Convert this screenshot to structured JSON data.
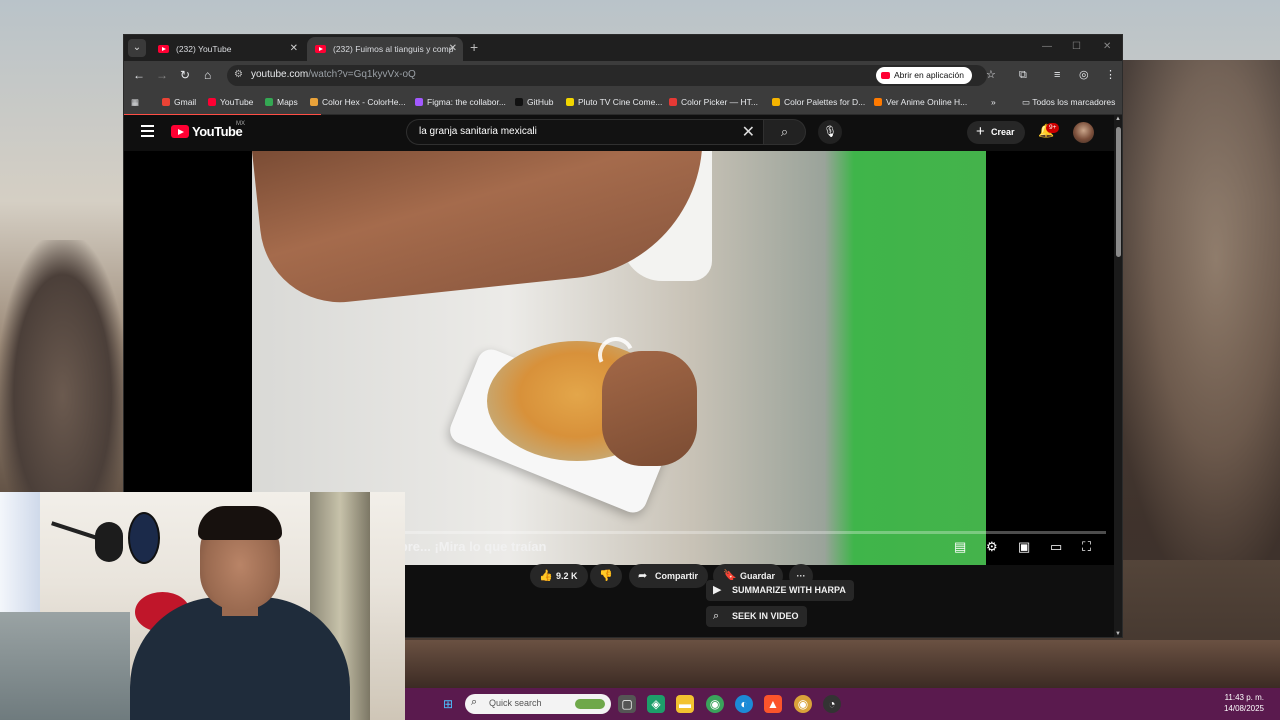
{
  "browser": {
    "tabs": [
      {
        "title": "(232) YouTube",
        "active": false
      },
      {
        "title": "(232) Fuimos al tianguis y comp",
        "active": true
      }
    ],
    "new_tab": "+",
    "window_controls": {
      "minimize": "—",
      "maximize": "☐",
      "close": "✕"
    },
    "address": {
      "host": "youtube.com",
      "path": "/watch?v=Gq1kyvVx-oQ"
    },
    "open_in_app": "Abrir en aplicación",
    "bookmarks": [
      {
        "label": "Gmail",
        "color": "#ea4335"
      },
      {
        "label": "YouTube",
        "color": "#ff0033"
      },
      {
        "label": "Maps",
        "color": "#34a853"
      },
      {
        "label": "Color Hex - ColorHe...",
        "color": "#e8a23a"
      },
      {
        "label": "Figma: the collabor...",
        "color": "#a259ff"
      },
      {
        "label": "GitHub",
        "color": "#111111"
      },
      {
        "label": "Pluto TV Cine Come...",
        "color": "#f2d600"
      },
      {
        "label": "Color Picker — HT...",
        "color": "#e53935"
      },
      {
        "label": "Color Palettes for D...",
        "color": "#f5b400"
      },
      {
        "label": "Ver Anime Online H...",
        "color": "#ff7a00"
      }
    ],
    "bookmarks_overflow": "»",
    "all_bookmarks": "Todos los marcadores"
  },
  "youtube": {
    "logo_text": "YouTube",
    "country": "MX",
    "search_query": "la granja sanitaria mexicali",
    "create_label": "Crear",
    "notifications_badge": "9+",
    "video_title": "resa de Mercado Libre... ¡Mira lo que traían",
    "actions": {
      "likes": "9.2 K",
      "share": "Compartir",
      "save": "Guardar",
      "more": "···"
    },
    "harpa": {
      "summarize": "SUMMARIZE WITH HARPA",
      "seek": "SEEK IN VIDEO"
    }
  },
  "taskbar": {
    "search_placeholder": "Quick search",
    "time": "11:43 p. m.",
    "date": "14/08/2025"
  },
  "colors": {
    "youtube_red": "#ff0033",
    "taskbar": "#5a1a4e",
    "browser_chrome": "#3c3c3c"
  }
}
